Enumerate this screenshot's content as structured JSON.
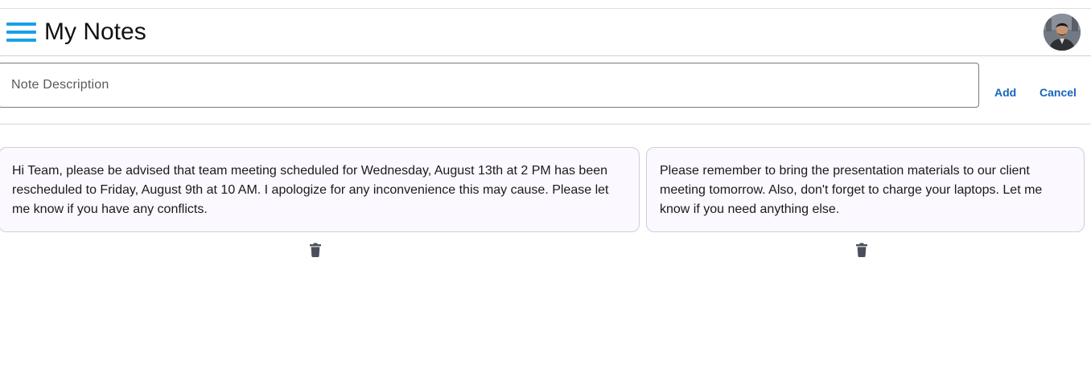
{
  "header": {
    "title": "My Notes",
    "menu_icon": "hamburger-menu-icon",
    "avatar_icon": "user-avatar",
    "accent_color": "#1aa0e6"
  },
  "note_form": {
    "placeholder": "Note Description",
    "value": "",
    "add_label": "Add",
    "cancel_label": "Cancel",
    "button_color": "#1565c0"
  },
  "notes": [
    {
      "text": "Hi Team, please be advised that team meeting scheduled for Wednesday, August 13th at 2 PM has been rescheduled to Friday, August 9th at 10 AM. I apologize for any inconvenience this may cause. Please let me know if you have any conflicts.",
      "delete_icon": "trash-icon"
    },
    {
      "text": "Please remember to bring the presentation materials to our client meeting tomorrow. Also, don't forget to charge your laptops. Let me know if you need anything else.",
      "delete_icon": "trash-icon"
    }
  ]
}
